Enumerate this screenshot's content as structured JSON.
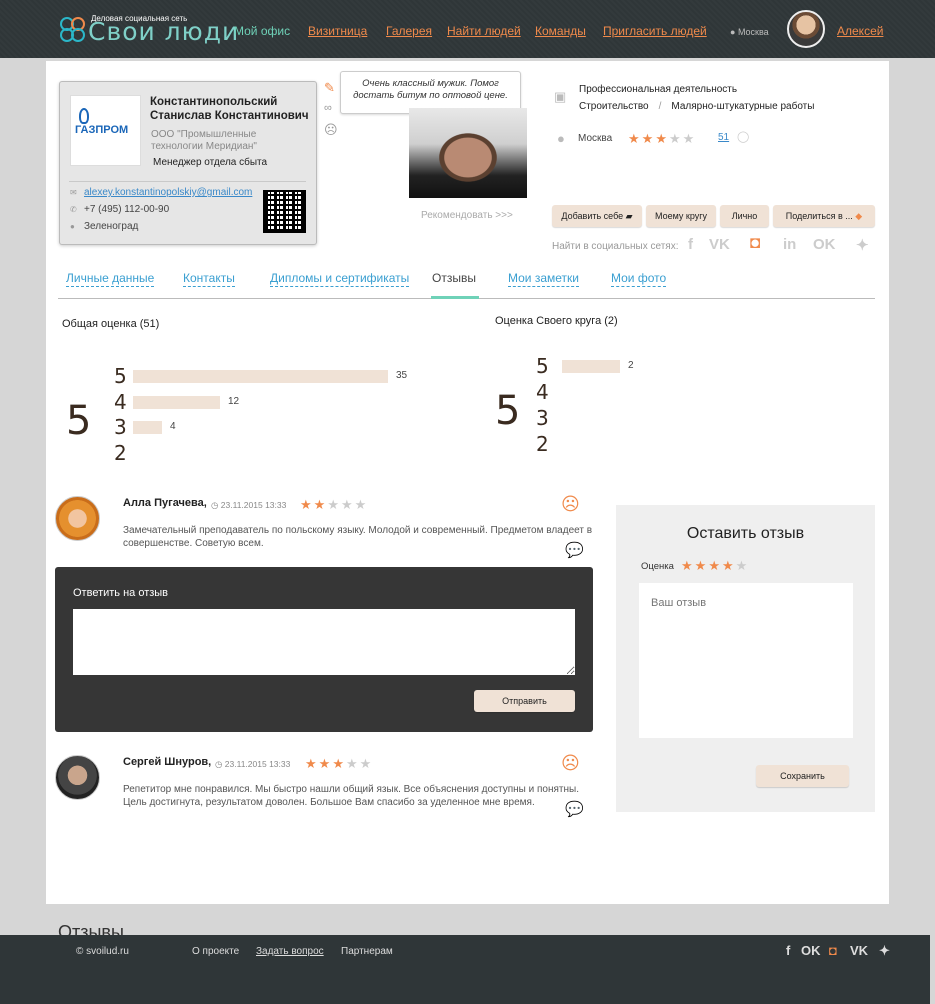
{
  "header": {
    "logo_tagline": "Деловая социальная сеть",
    "logo_text": "Свои люди",
    "nav": [
      "Мой офис",
      "Визитница",
      "Галерея",
      "Найти людей",
      "Команды",
      "Пригласить людей"
    ],
    "city": "Москва",
    "user_name": "Алексей"
  },
  "card": {
    "company_logo": "ГАЗПРОМ",
    "name": "Константинопольский Станислав Константинович",
    "company": "ООО \"Промышленные технологии Меридиан\"",
    "position": "Менеджер отдела сбыта",
    "email": "alexey.konstantinopolskiy@gmail.com",
    "phone": "+7 (495) 112-00-90",
    "city": "Зеленоград"
  },
  "note": "Очень классный мужик. Помог достать битум по оптовой цене.",
  "recommend_label": "Рекомендовать >>>",
  "profession": {
    "title": "Профессиональная деятельность",
    "category": "Строительство",
    "subcategory": "Малярно-штукатурные работы",
    "city": "Москва",
    "rating": 3,
    "reviews_count": "51"
  },
  "actions": {
    "add": "Добавить себе",
    "circle": "Моему кругу",
    "personal": "Лично",
    "share": "Поделиться в ..."
  },
  "social_label": "Найти в социальных сетях:",
  "tabs": [
    "Личные данные",
    "Контакты",
    "Дипломы и сертификаты",
    "Отзывы",
    "Мои заметки",
    "Мои фото"
  ],
  "overall": {
    "title": "Общая оценка (51)",
    "average": "5",
    "levels": [
      {
        "label": "5",
        "count": 35
      },
      {
        "label": "4",
        "count": 12
      },
      {
        "label": "3",
        "count": 4
      },
      {
        "label": "2",
        "count": null
      }
    ]
  },
  "circle_rating": {
    "title": "Оценка Своего круга (2)",
    "average": "5",
    "levels": [
      {
        "label": "5",
        "count": 2
      },
      {
        "label": "4",
        "count": null
      },
      {
        "label": "3",
        "count": null
      },
      {
        "label": "2",
        "count": null
      }
    ]
  },
  "reviews": [
    {
      "name": "Алла Пугачева,",
      "date": "23.11.2015 13:33",
      "rating": 2,
      "text": "Замечательный преподаватель по польскому языку. Молодой и современный. Предметом владеет в совершенстве. Советую всем."
    },
    {
      "name": "Сергей Шнуров,",
      "date": "23.11.2015 13:33",
      "rating": 3,
      "text": "Репетитор мне понравился. Мы быстро нашли общий язык. Все объяснения доступны и понятны. Цель достигнута, результатом доволен. Большое Вам спасибо за уделенное мне время."
    }
  ],
  "reply": {
    "title": "Ответить на отзыв",
    "button": "Отправить"
  },
  "leave_review": {
    "title": "Оставить отзыв",
    "rating_label": "Оценка",
    "rating": 4,
    "placeholder": "Ваш отзыв",
    "button": "Сохранить"
  },
  "section_heading": "Отзывы",
  "footer": {
    "copyright": "© svoilud.ru",
    "links": [
      "О проекте",
      "Задать вопрос",
      "Партнерам"
    ]
  },
  "colors": {
    "accent": "#f08a4b",
    "teal": "#6fd2b8",
    "link": "#3a9fd1",
    "bar": "#f0e2d6",
    "dark": "#2f3638"
  }
}
